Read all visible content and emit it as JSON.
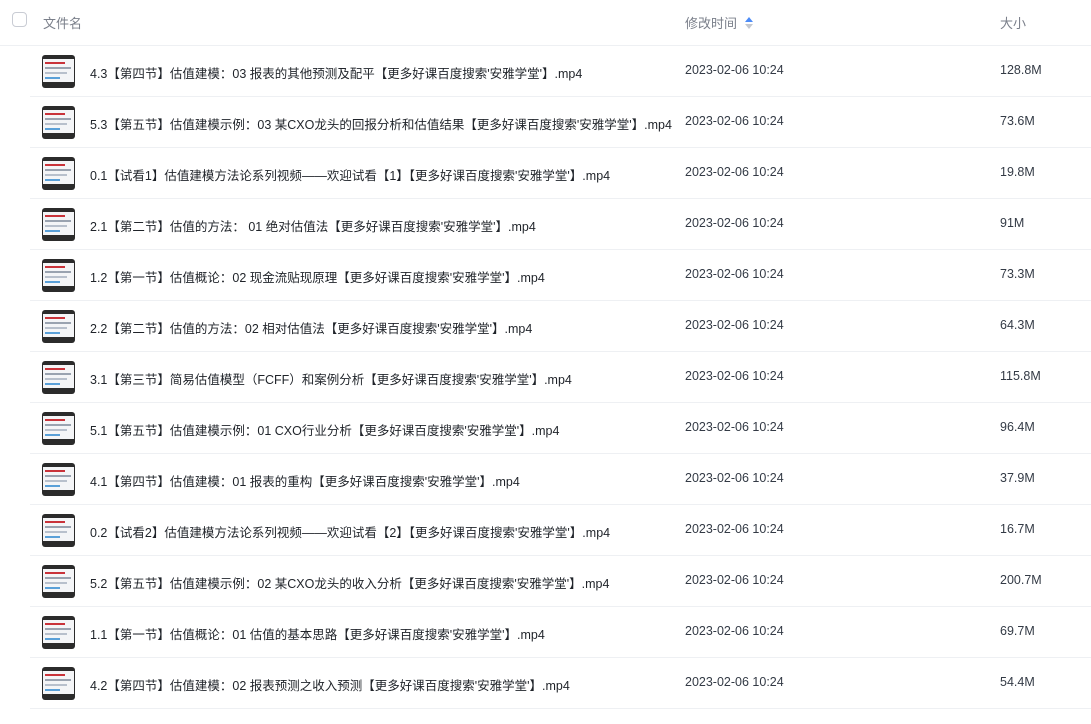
{
  "header": {
    "name_label": "文件名",
    "time_label": "修改时间",
    "size_label": "大小"
  },
  "rows": [
    {
      "name": "4.3【第四节】估值建模：03 报表的其他预测及配平【更多好课百度搜索'安雅学堂'】.mp4",
      "time": "2023-02-06 10:24",
      "size": "128.8M"
    },
    {
      "name": "5.3【第五节】估值建模示例：03 某CXO龙头的回报分析和估值结果【更多好课百度搜索'安雅学堂'】.mp4",
      "time": "2023-02-06 10:24",
      "size": "73.6M"
    },
    {
      "name": "0.1【试看1】估值建模方法论系列视频——欢迎试看【1】【更多好课百度搜索'安雅学堂'】.mp4",
      "time": "2023-02-06 10:24",
      "size": "19.8M"
    },
    {
      "name": "2.1【第二节】估值的方法： 01 绝对估值法【更多好课百度搜索'安雅学堂'】.mp4",
      "time": "2023-02-06 10:24",
      "size": "91M"
    },
    {
      "name": "1.2【第一节】估值概论：02 现金流贴现原理【更多好课百度搜索'安雅学堂'】.mp4",
      "time": "2023-02-06 10:24",
      "size": "73.3M"
    },
    {
      "name": "2.2【第二节】估值的方法：02 相对估值法【更多好课百度搜索'安雅学堂'】.mp4",
      "time": "2023-02-06 10:24",
      "size": "64.3M"
    },
    {
      "name": "3.1【第三节】简易估值模型（FCFF）和案例分析【更多好课百度搜索'安雅学堂'】.mp4",
      "time": "2023-02-06 10:24",
      "size": "115.8M"
    },
    {
      "name": "5.1【第五节】估值建模示例：01 CXO行业分析【更多好课百度搜索'安雅学堂'】.mp4",
      "time": "2023-02-06 10:24",
      "size": "96.4M"
    },
    {
      "name": "4.1【第四节】估值建模：01 报表的重构【更多好课百度搜索'安雅学堂'】.mp4",
      "time": "2023-02-06 10:24",
      "size": "37.9M"
    },
    {
      "name": "0.2【试看2】估值建模方法论系列视频——欢迎试看【2】【更多好课百度搜索'安雅学堂'】.mp4",
      "time": "2023-02-06 10:24",
      "size": "16.7M"
    },
    {
      "name": "5.2【第五节】估值建模示例：02 某CXO龙头的收入分析【更多好课百度搜索'安雅学堂'】.mp4",
      "time": "2023-02-06 10:24",
      "size": "200.7M"
    },
    {
      "name": "1.1【第一节】估值概论：01 估值的基本思路【更多好课百度搜索'安雅学堂'】.mp4",
      "time": "2023-02-06 10:24",
      "size": "69.7M"
    },
    {
      "name": "4.2【第四节】估值建模：02 报表预测之收入预测【更多好课百度搜索'安雅学堂'】.mp4",
      "time": "2023-02-06 10:24",
      "size": "54.4M"
    }
  ]
}
